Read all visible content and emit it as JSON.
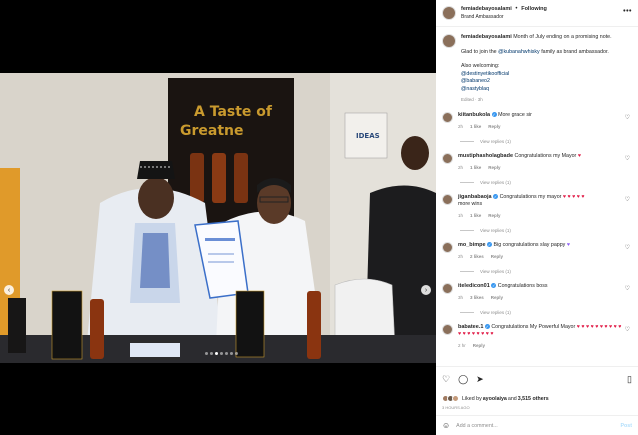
{
  "post": {
    "username": "femiadebayosalami",
    "subtitle": "Brand Ambassador",
    "separator": "•",
    "follow_status": "Following",
    "more_icon": "•••"
  },
  "caption": {
    "username": "femiadebayosalami",
    "line1": "Month of July ending on a promising note.",
    "line2_pre": "Glad to join the ",
    "line2_link": "@kubanahwhisky",
    "line2_post": " family as brand ambassador.",
    "line3": "Also welcoming:",
    "mentions": [
      "@destinyetikoofficial",
      "@babaneo2",
      "@nastyblaq"
    ],
    "meta": "Edited · 3h"
  },
  "comments": [
    {
      "username": "kiitanbukola",
      "verified": true,
      "text": "More grace sir",
      "time": "2h",
      "likes": "1 like",
      "reply": "Reply",
      "view_replies": "View replies (1)"
    },
    {
      "username": "mustiphasholagbade",
      "verified": false,
      "text": "Congratulations my Mayor",
      "emoji": "♥",
      "time": "2h",
      "likes": "1 like",
      "reply": "Reply",
      "view_replies": "View replies (1)"
    },
    {
      "username": "jiganbabaoja",
      "verified": true,
      "text": "Congratulations my mayor",
      "emoji": "♥ ♥ ♥ ♥ ♥",
      "text2": "more wins",
      "time": "1h",
      "likes": "1 like",
      "reply": "Reply",
      "view_replies": "View replies (1)"
    },
    {
      "username": "mo_bimpe",
      "verified": true,
      "text": "Big congratulations slay pappy",
      "emoji": "♥",
      "time": "2h",
      "likes": "2 likes",
      "reply": "Reply",
      "view_replies": "View replies (1)"
    },
    {
      "username": "iteledicon01",
      "verified": true,
      "text": "Congratulations boss",
      "time": "3h",
      "likes": "3 likes",
      "reply": "Reply",
      "view_replies": "View replies (1)"
    },
    {
      "username": "babatee.1",
      "verified": true,
      "text": "Congratulations My Powerful Mayor",
      "emoji": "♥ ♥ ♥ ♥ ♥ ♥ ♥ ♥ ♥ ♥ ♥ ♥ ♥ ♥ ♥ ♥ ♥ ♥",
      "time": "2 hr",
      "likes": "",
      "reply": "Reply",
      "view_replies": ""
    }
  ],
  "photo": {
    "banner_line1": "A Taste of",
    "banner_line2": "Greatne",
    "ideas_sign": "IDEAS"
  },
  "footer": {
    "liked_by_pre": "Liked by ",
    "liked_by_user": "ayoolaiya",
    "liked_by_mid": " and ",
    "liked_by_count": "3,515 others",
    "time_ago": "3 hours ago",
    "add_comment_placeholder": "Add a comment...",
    "post_label": "Post"
  },
  "colors": {
    "link": "#00376b",
    "verified": "#3897f0",
    "heart": "#e11d48"
  }
}
